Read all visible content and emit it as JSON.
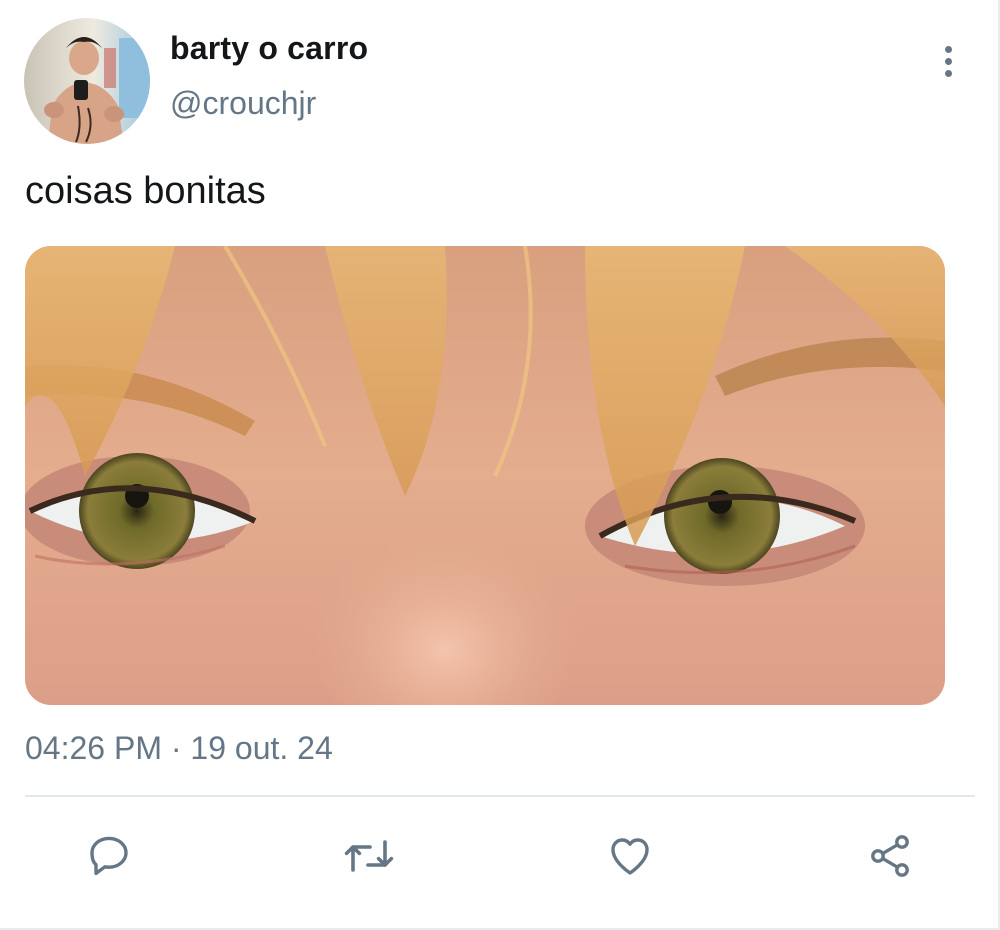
{
  "tweet": {
    "display_name": "barty o carro",
    "handle": "@crouchjr",
    "text": "coisas bonitas",
    "timestamp": "04:26 PM · 19 out. 24"
  },
  "actions": {
    "reply_icon": "speech-bubble-icon",
    "retweet_icon": "retweet-arrows-icon",
    "like_icon": "heart-icon",
    "share_icon": "share-nodes-icon"
  },
  "colors": {
    "primary_text": "#14171a",
    "secondary_text": "#657786",
    "divider": "#e1e8ed"
  }
}
